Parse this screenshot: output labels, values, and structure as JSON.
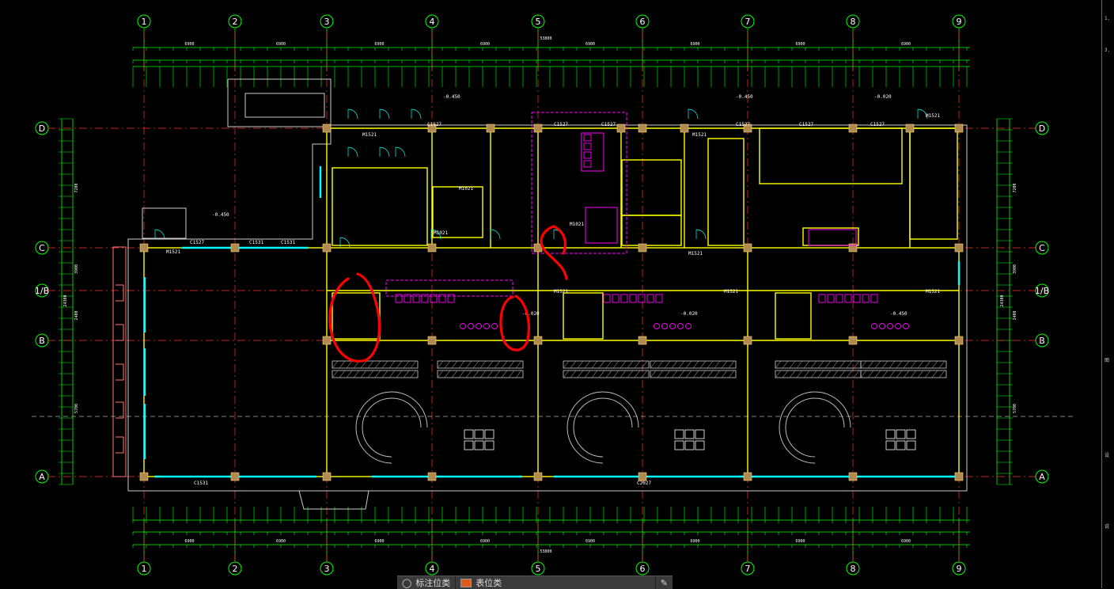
{
  "axes": {
    "vertical": [
      "1",
      "2",
      "3",
      "4",
      "5",
      "6",
      "7",
      "8",
      "9"
    ],
    "horizontal": [
      "D",
      "C",
      "1/B",
      "B",
      "A"
    ]
  },
  "dimensions": {
    "top_total": "53800",
    "bottom_total": "53800",
    "top_segment": [
      "6900",
      "6900",
      "6900",
      "6900",
      "6900",
      "6900",
      "6900",
      "6900"
    ],
    "bottom_segment": [
      "6900",
      "6900",
      "6900",
      "6900",
      "6900",
      "6900",
      "6900",
      "6900"
    ],
    "left_total": "24300",
    "right_total": "24300",
    "left_segments": [
      "7200",
      "3900",
      "2400",
      "5700"
    ],
    "right_segments": [
      "7200",
      "3900",
      "2400",
      "5700"
    ]
  },
  "elevations": [
    "-0.450",
    "-0.450",
    "-0.450",
    "-0.020",
    "-0.020",
    "-0.020",
    "-0.450"
  ],
  "door_labels": [
    "M1521",
    "M1521",
    "M1521",
    "M1021",
    "M1021",
    "M1021",
    "M1521",
    "M1521",
    "M1521",
    "M1521",
    "M1521"
  ],
  "window_labels": [
    "C1527",
    "C1527",
    "C1527",
    "C1527",
    "C1527",
    "C1527",
    "C1527",
    "C1531",
    "C1531",
    "C1531",
    "C2027"
  ],
  "toolbar": {
    "item1_label": "标注位类",
    "item2_label": "表位类"
  },
  "colors": {
    "grid_green": "#00ff00",
    "axis_red": "#ff3030",
    "wall_yellow": "#ffff00",
    "window_cyan": "#00ffff",
    "fixture_magenta": "#ff00ff",
    "markup_red": "#ff0000",
    "column_fill": "#b08a50"
  }
}
